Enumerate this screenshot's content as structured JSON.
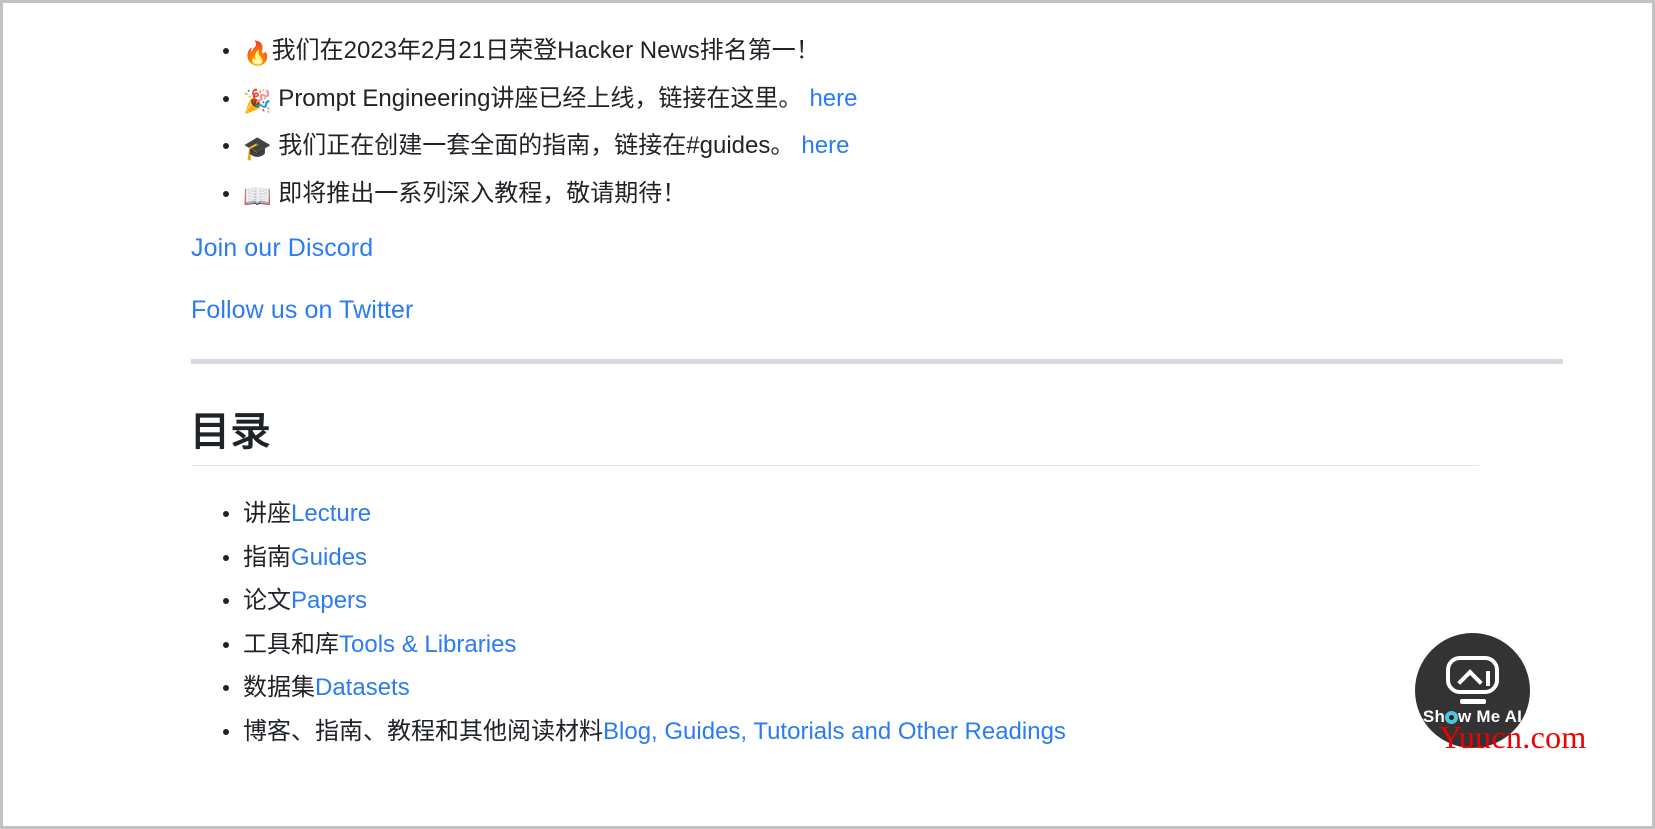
{
  "page": {
    "background": "#ffffff",
    "border_color": "#c2c2c2",
    "text_color": "#1f2328",
    "link_color": "#2b7cf0"
  },
  "announcements": [
    {
      "icon": "fire-emoji",
      "glyph": "🔥",
      "text": "我们在2023年2月21日荣登Hacker News排名第一！",
      "link_label": ""
    },
    {
      "icon": "party-popper-emoji",
      "glyph": "🎉",
      "text": " Prompt Engineering讲座已经上线，链接在这里。",
      "link_label": "here"
    },
    {
      "icon": "graduation-cap-emoji",
      "glyph": "🎓",
      "text": " 我们正在创建一套全面的指南，链接在#guides。",
      "link_label": "here"
    },
    {
      "icon": "open-book-emoji",
      "glyph": "📖",
      "text": " 即将推出一系列深入教程，敬请期待！",
      "link_label": ""
    }
  ],
  "social": {
    "discord": "Join our Discord",
    "twitter": "Follow us on Twitter"
  },
  "toc": {
    "heading": "目录",
    "items": [
      {
        "cn": "讲座",
        "en": "Lecture"
      },
      {
        "cn": "指南",
        "en": "Guides"
      },
      {
        "cn": "论文",
        "en": "Papers"
      },
      {
        "cn": "工具和库",
        "en": "Tools & Libraries"
      },
      {
        "cn": "数据集",
        "en": "Datasets"
      },
      {
        "cn": "博客、指南、教程和其他阅读材料",
        "en": "Blog, Guides, Tutorials and Other Readings"
      }
    ]
  },
  "watermark": {
    "brand": "Show Me AI",
    "brand_prefix": "Sh",
    "brand_suffix": "w Me AI",
    "site": "Yuucn.com",
    "badge_color": "#333333",
    "eye_color": "#4ec6dd",
    "site_color": "#ee0000"
  }
}
